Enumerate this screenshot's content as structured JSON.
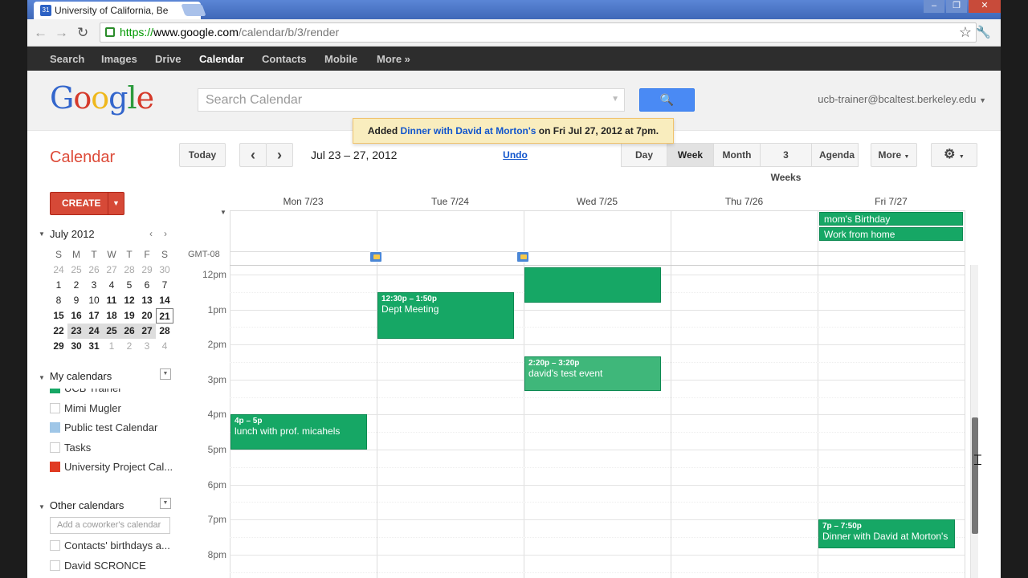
{
  "browser": {
    "tab_title": "University of California, Be",
    "tab_icon": "calendar-favicon",
    "url_scheme": "https://",
    "url_host": "www.google.com",
    "url_path": "/calendar/b/3/render"
  },
  "gbar": {
    "items": [
      "Search",
      "Images",
      "Drive",
      "Calendar",
      "Contacts",
      "Mobile",
      "More »"
    ],
    "active": "Calendar"
  },
  "header": {
    "logo": "Google",
    "search_placeholder": "Search Calendar",
    "user": "ucb-trainer@bcaltest.berkeley.edu"
  },
  "notice": {
    "prefix": "Added",
    "event_link": "Dinner with David at Morton's",
    "suffix": "on Fri Jul 27, 2012 at 7pm.",
    "undo": "Undo"
  },
  "calbar": {
    "title": "Calendar",
    "today": "Today",
    "prev": "‹",
    "next": "›",
    "date_range": "Jul 23 – 27, 2012",
    "views": [
      "Day",
      "Week",
      "Month",
      "3 Weeks",
      "Agenda"
    ],
    "selected_view": "Week",
    "more": "More",
    "settings_icon": "gear-icon"
  },
  "sidebar": {
    "create": "CREATE",
    "mini_cal": {
      "title": "July 2012",
      "dow": [
        "S",
        "M",
        "T",
        "W",
        "T",
        "F",
        "S"
      ],
      "weeks": [
        [
          "24",
          "25",
          "26",
          "27",
          "28",
          "29",
          "30"
        ],
        [
          "1",
          "2",
          "3",
          "4",
          "5",
          "6",
          "7"
        ],
        [
          "8",
          "9",
          "10",
          "11",
          "12",
          "13",
          "14"
        ],
        [
          "15",
          "16",
          "17",
          "18",
          "19",
          "20",
          "21"
        ],
        [
          "22",
          "23",
          "24",
          "25",
          "26",
          "27",
          "28"
        ],
        [
          "29",
          "30",
          "31",
          "1",
          "2",
          "3",
          "4"
        ]
      ]
    },
    "my_calendars": {
      "title": "My calendars",
      "items": [
        {
          "label": "UCB Trainer",
          "color": "#16a765"
        },
        {
          "label": "Mimi Mugler",
          "color": ""
        },
        {
          "label": "Public test Calendar",
          "color": "#9fc6e7"
        },
        {
          "label": "Tasks",
          "color": ""
        },
        {
          "label": "University Project Cal...",
          "color": "#e03a22"
        }
      ]
    },
    "other_calendars": {
      "title": "Other calendars",
      "add_placeholder": "Add a coworker's calendar",
      "items": [
        {
          "label": "Contacts' birthdays a..."
        },
        {
          "label": "David SCRONCE"
        }
      ]
    }
  },
  "week": {
    "days": [
      "Mon 7/23",
      "Tue 7/24",
      "Wed 7/25",
      "Thu 7/26",
      "Fri 7/27"
    ],
    "timezone": "GMT-08",
    "hours": [
      "12pm",
      "1pm",
      "2pm",
      "3pm",
      "4pm",
      "5pm",
      "6pm",
      "7pm",
      "8pm"
    ],
    "all_day_events": [
      {
        "day": 4,
        "title": "mom's Birthday"
      },
      {
        "day": 4,
        "title": "Work from home"
      }
    ],
    "events": [
      {
        "day": 1,
        "start": 12.5,
        "end": 13.83,
        "time": "12:30p – 1:50p",
        "title": "Dept Meeting"
      },
      {
        "day": 2,
        "start": 11.8,
        "end": 12.8,
        "time": "",
        "title": ""
      },
      {
        "day": 2,
        "start": 14.33,
        "end": 15.33,
        "time": "2:20p – 3:20p",
        "title": "david's test event"
      },
      {
        "day": 0,
        "start": 16.0,
        "end": 17.0,
        "time": "4p – 5p",
        "title": "lunch with prof. micahels"
      },
      {
        "day": 4,
        "start": 19.0,
        "end": 19.83,
        "time": "7p – 7:50p",
        "title": "Dinner with David at Morton's"
      }
    ],
    "color": "#16a765"
  }
}
